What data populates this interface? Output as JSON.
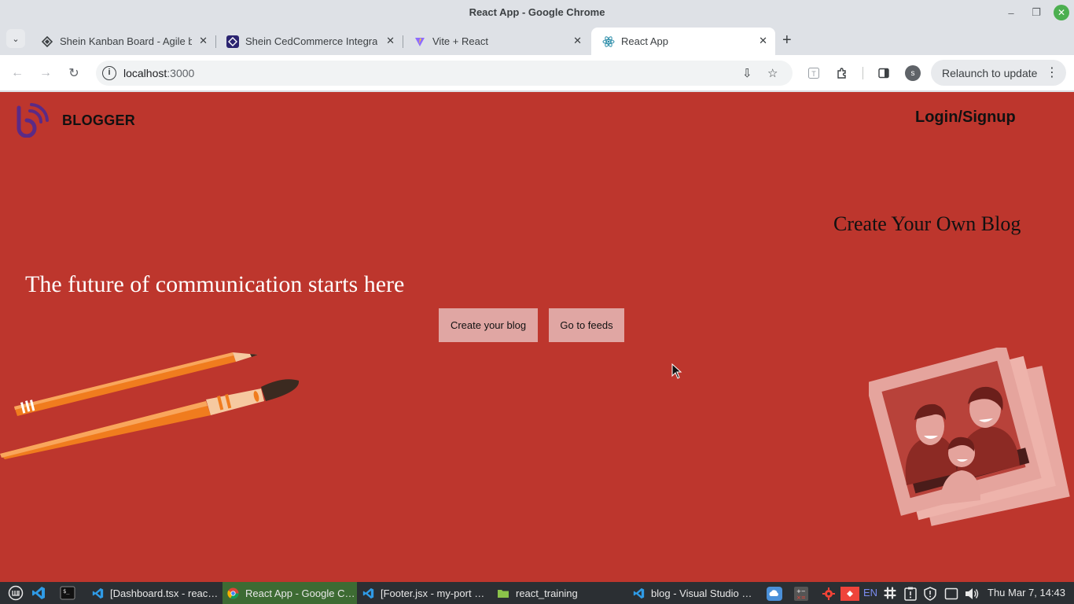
{
  "window": {
    "title": "React App - Google Chrome",
    "controls": {
      "minimize": "–",
      "maximize": "❐",
      "close": "✕"
    }
  },
  "tabs": [
    {
      "label": "Shein Kanban Board - Agile b",
      "icon": "jira-icon",
      "close": "✕"
    },
    {
      "label": "Shein CedCommerce Integra",
      "icon": "cedcommerce-icon",
      "close": "✕"
    },
    {
      "label": "Vite + React",
      "icon": "vite-icon",
      "close": "✕"
    },
    {
      "label": "React App",
      "icon": "react-icon",
      "close": "✕",
      "active": true
    }
  ],
  "tabstrip": {
    "search_icon": "⌄",
    "new_tab": "+"
  },
  "toolbar": {
    "back": "←",
    "forward": "→",
    "reload": "↻",
    "url_host": "localhost",
    "url_port": ":3000",
    "info_icon": "i",
    "install_icon": "⇩",
    "star_icon": "☆",
    "profile_initial": "s",
    "relaunch_label": "Relaunch to update",
    "menu_icon": "⋮"
  },
  "page": {
    "brand": "BLOGGER",
    "login": "Login/Signup",
    "create_own": "Create Your Own Blog",
    "headline": "The future of communication starts here",
    "create_blog_button": "Create your blog",
    "feeds_button": "Go to feeds",
    "colors": {
      "background": "#bd362d",
      "button": "#e0a6a3",
      "logo": "#5b2a86"
    }
  },
  "taskbar": {
    "items": [
      {
        "label": "[Dashboard.tsx - reac…",
        "icon": "vscode-icon"
      },
      {
        "label": "React App - Google C…",
        "icon": "chrome-icon",
        "active": true
      },
      {
        "label": "[Footer.jsx - my-port …",
        "icon": "vscode-icon"
      },
      {
        "label": "react_training",
        "icon": "folder-icon"
      },
      {
        "label": "blog - Visual Studio …",
        "icon": "vscode-icon"
      }
    ],
    "lang": "EN",
    "clock": "Thu Mar 7, 14:43"
  }
}
